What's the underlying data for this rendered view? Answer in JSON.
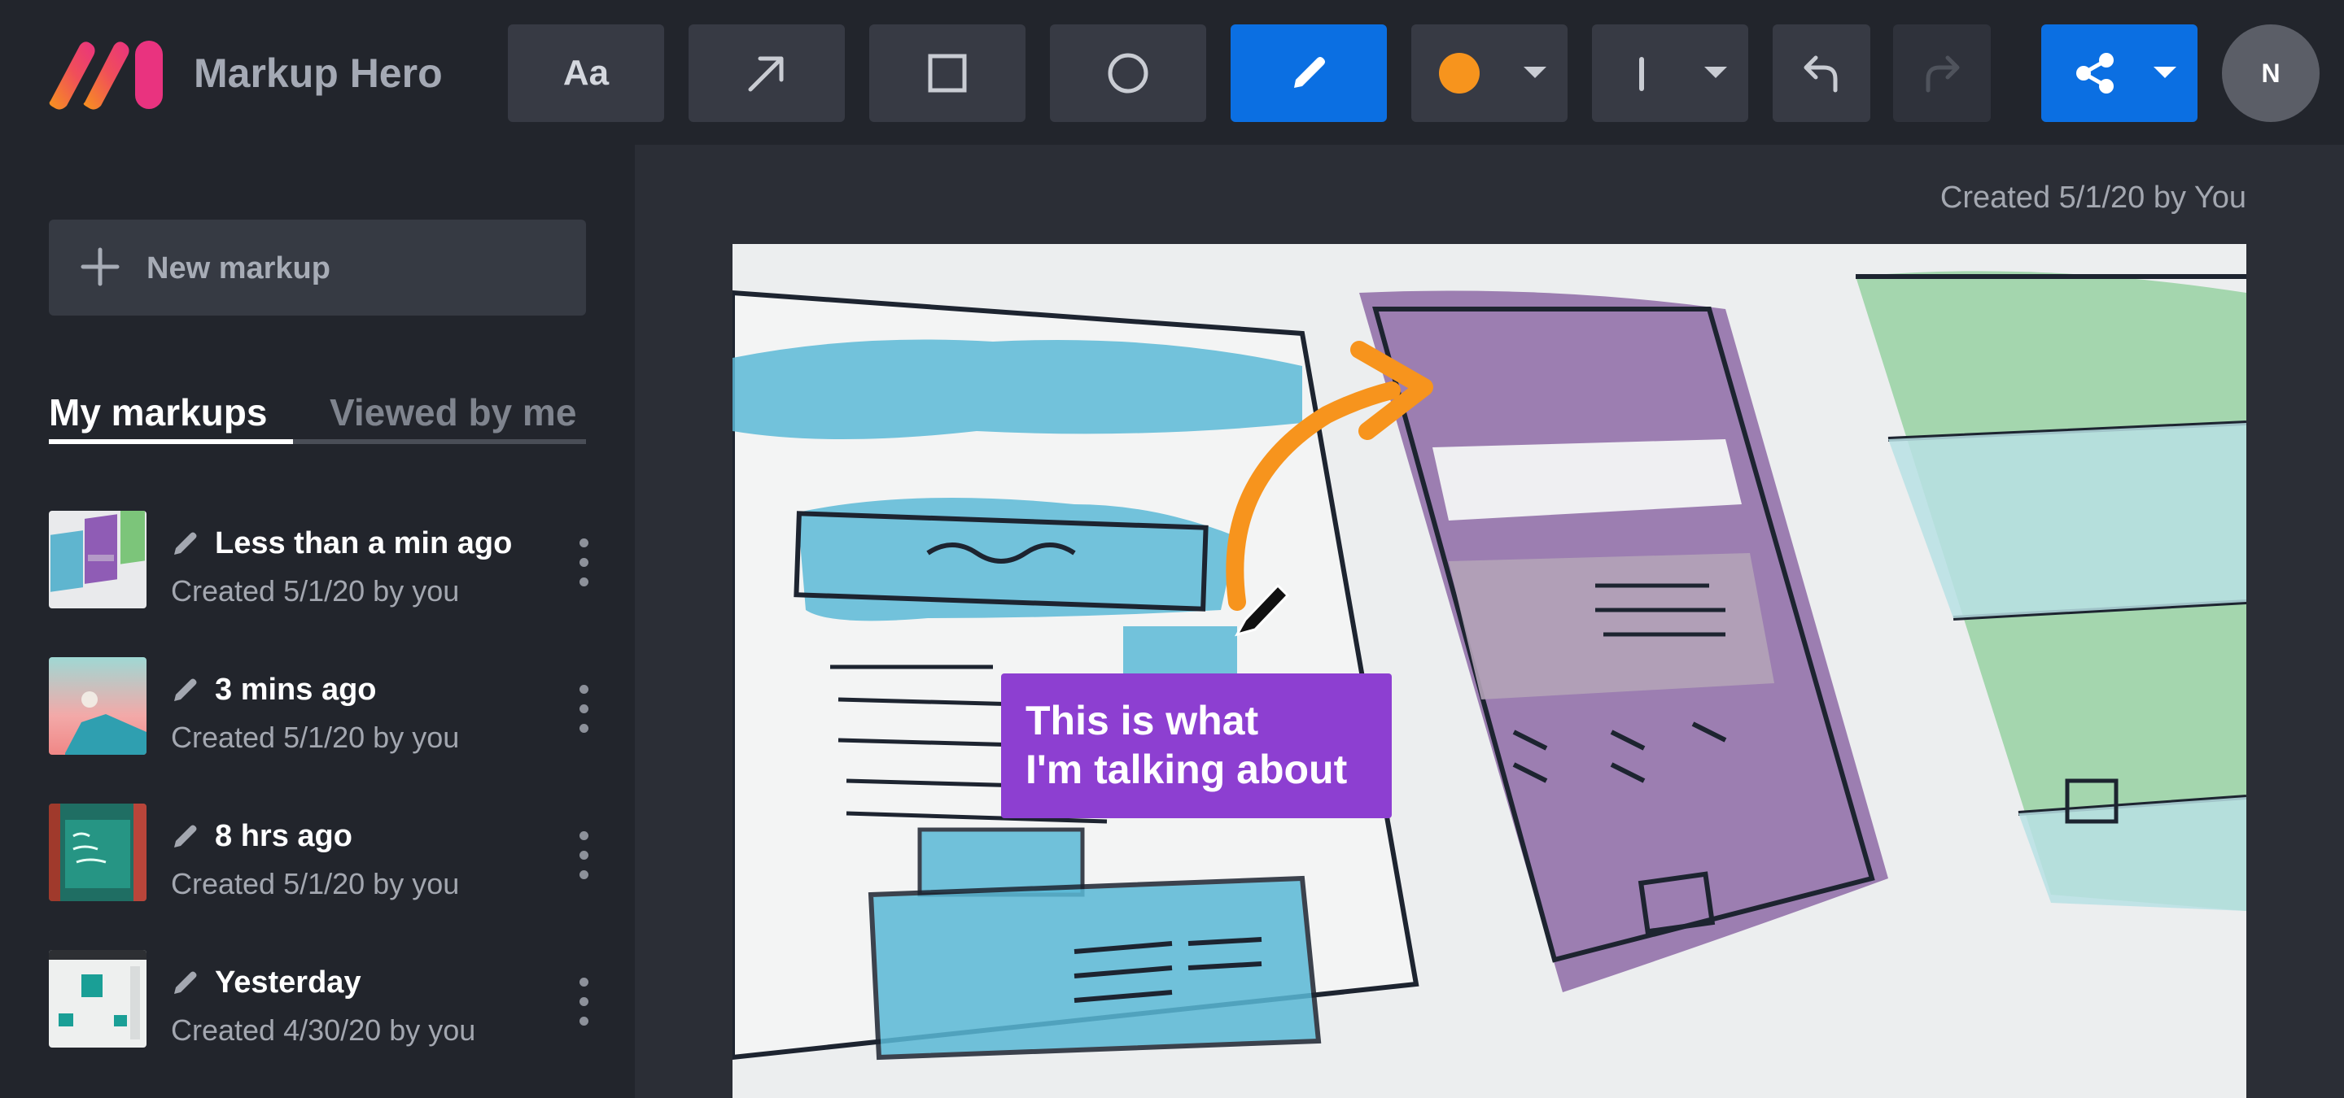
{
  "app": {
    "title": "Markup Hero"
  },
  "toolbar": {
    "text_tool_label": "Aa",
    "tools": [
      {
        "name": "text",
        "icon": "text-icon"
      },
      {
        "name": "arrow",
        "icon": "arrow-icon"
      },
      {
        "name": "rectangle",
        "icon": "rectangle-icon"
      },
      {
        "name": "ellipse",
        "icon": "circle-icon"
      },
      {
        "name": "pen",
        "icon": "pencil-icon",
        "active": true
      },
      {
        "name": "color",
        "icon": "color-swatch-icon"
      },
      {
        "name": "stroke",
        "icon": "stroke-width-icon"
      },
      {
        "name": "undo",
        "icon": "undo-icon"
      },
      {
        "name": "redo",
        "icon": "redo-icon",
        "disabled": true
      },
      {
        "name": "share",
        "icon": "share-icon"
      }
    ],
    "active_color": "#f7941d",
    "accent_color": "#0b6fe2",
    "avatar_initial": "N"
  },
  "sidebar": {
    "new_markup_label": "New markup",
    "tabs": [
      {
        "label": "My markups",
        "active": true
      },
      {
        "label": "Viewed by me",
        "active": false
      }
    ],
    "items": [
      {
        "title": "Less than a min ago",
        "subtitle": "Created 5/1/20 by you"
      },
      {
        "title": "3 mins ago",
        "subtitle": "Created 5/1/20 by you"
      },
      {
        "title": "8 hrs ago",
        "subtitle": "Created 5/1/20 by you"
      },
      {
        "title": "Yesterday",
        "subtitle": "Created 4/30/20 by you"
      }
    ]
  },
  "main": {
    "created_meta": "Created 5/1/20 by You",
    "callout": {
      "line1": "This is what",
      "line2": "I'm talking about",
      "color": "#8d3fd1"
    },
    "annotation_arrow_color": "#f7941d"
  }
}
